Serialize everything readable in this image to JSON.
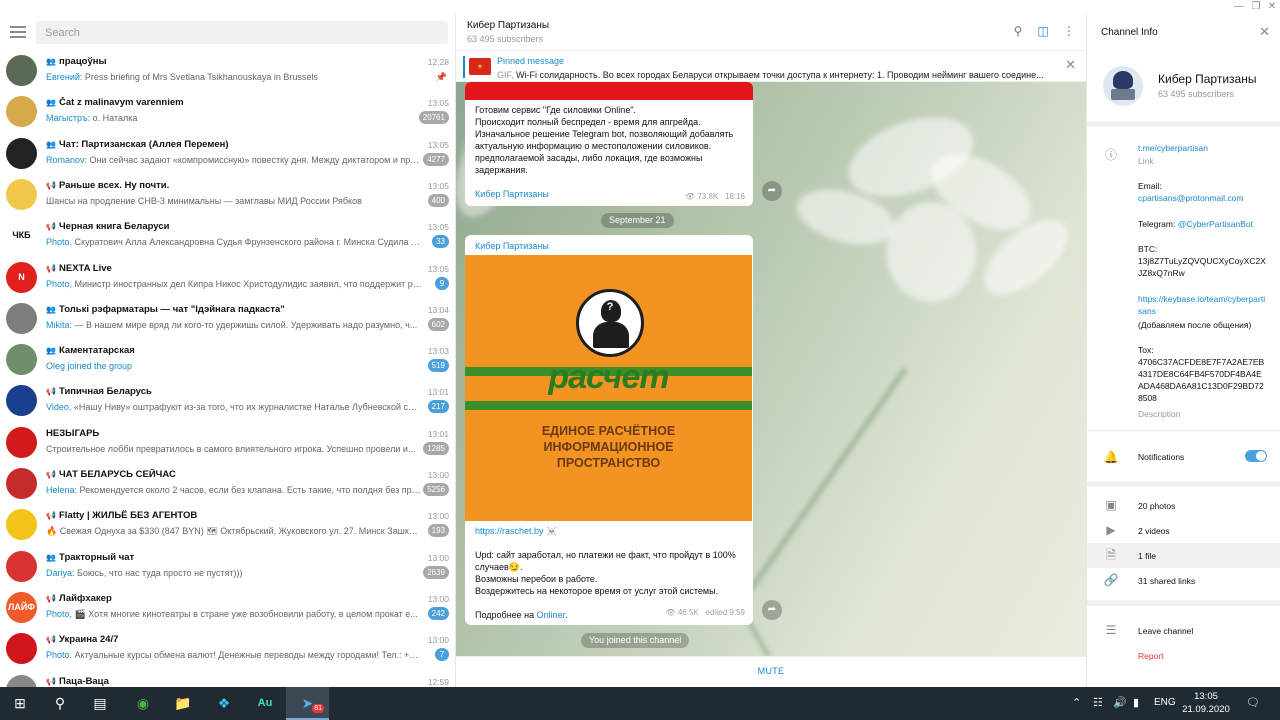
{
  "sidebar": {
    "search_placeholder": "Search",
    "chats": [
      {
        "type": "group",
        "name": "працоўны",
        "time": "12:28",
        "sender": "Евгений: ",
        "preview": "Press briefing of Mrs Svetlana Tsikhanouskaya in Brussels",
        "badge": "",
        "pinned": true,
        "avatar": "",
        "color": "#5a6a55"
      },
      {
        "type": "group",
        "name": "Čat z malinavym varenniem",
        "time": "13:05",
        "sender": "Магыстръ: ",
        "preview": "о. Наталка",
        "badge": "20761",
        "avatar": "",
        "color": "#d6a94a"
      },
      {
        "type": "group",
        "name": "Чат: Партизанская (Аллея Перемен)",
        "time": "13:05",
        "sender": "Romanov: ",
        "preview": "Они сейчас задают «компромиссную» повестку дня. Между диктатором и про...",
        "badge": "4277",
        "avatar": "",
        "color": "#222222"
      },
      {
        "type": "channel",
        "name": "Раньше всех. Ну почти.",
        "time": "13:05",
        "sender": "",
        "preview": "Шансы на продление СНВ-3 минимальны — замглавы МИД России Рябков",
        "badge": "400",
        "avatar": "",
        "color": "#f2c84a"
      },
      {
        "type": "channel",
        "name": "Черная книга Беларуси",
        "time": "13:05",
        "sender": "Photo, ",
        "preview": "Скуратович Алла Александровна Судья Фрунзенского района г. Минска Судила об...",
        "badge": "33",
        "badge_blue": true,
        "avatar": "ЧКБ",
        "color": "#ffffff"
      },
      {
        "type": "channel",
        "name": "NEXTA Live",
        "time": "13:05",
        "sender": "Photo, ",
        "preview": "Министр иностранных дел Кипра Никос Христодулидис заявил, что поддержит реше...",
        "badge": "9",
        "badge_blue": true,
        "avatar": "N",
        "color": "#e21f1f"
      },
      {
        "type": "group",
        "name": "Толькі рэфарматары — чат \"Ідэйнага падкаста\"",
        "time": "13:04",
        "sender": "Mikita: ",
        "preview": "— В нашем мире вряд ли кого-то удержишь силой. Удерживать надо разумно, ч...",
        "badge": "602",
        "avatar": "",
        "color": "#7d7d7d"
      },
      {
        "type": "group",
        "name": "Каментатарская",
        "time": "13:03",
        "sender": "",
        "preview": "Oleg joined the group",
        "badge": "519",
        "badge_blue": true,
        "preview_link": true,
        "avatar": "",
        "color": "#6f8f6a"
      },
      {
        "type": "channel",
        "name": "Типичная Беларусь",
        "time": "13:01",
        "sender": "Video, ",
        "preview": "«Нашу Ниву» оштрафуют из-за того, что их журналистке Наталье Лубневской сило...",
        "badge": "217",
        "badge_blue": true,
        "avatar": "",
        "color": "#1b3f8f"
      },
      {
        "type": "",
        "name": "НЕЗЫГАРЬ",
        "time": "13:01",
        "sender": "",
        "preview": "Строительное лобби превратилось в самого влиятельного игрока. Успешно провели и...",
        "badge": "1285",
        "avatar": "",
        "color": "#d11b1b"
      },
      {
        "type": "channel",
        "name": "ЧАТ БЕЛАРУСЬ СЕЙЧАС",
        "time": "13:00",
        "sender": "Helena: ",
        "preview": "Рекомендуется около 2 часов, если без клапана. Есть такие, что полдня без проб...",
        "badge": "5256",
        "avatar": "",
        "color": "#c62b2b"
      },
      {
        "type": "channel",
        "name": "Flatty | ЖИЛЬЁ БЕЗ АГЕНТОВ",
        "time": "13:00",
        "sender": "",
        "preview": "🔥 Свежая Однуха за $330 (847 BYN) 🗺 Октябрьский, Жуковского ул. 27. Минск Зашкварe...",
        "badge": "193",
        "avatar": "",
        "color": "#f2c318"
      },
      {
        "type": "group",
        "name": "Тракторный чат",
        "time": "13:00",
        "sender": "Dariya: ",
        "preview": "Боюсь, что нас туда просто не пустят)))",
        "badge": "2639",
        "avatar": "",
        "color": "#d83232"
      },
      {
        "type": "channel",
        "name": "Лайфхакер",
        "time": "13:00",
        "sender": "Photo, ",
        "preview": "🎬 Хотя многие кинотеатры в стране уже возобновили работу, в целом прокат е...",
        "badge": "242",
        "badge_blue": true,
        "avatar": "ЛАЙФ ХАКЕР",
        "color": "#f15a29"
      },
      {
        "type": "channel",
        "name": "Украина 24/7",
        "time": "13:00",
        "sender": "Photo. ",
        "preview": "Актуальные курсы обмена валют! Денежные переводы между городами! Тел.: +38...",
        "badge": "7",
        "badge_blue": true,
        "avatar": "",
        "color": "#d0151c"
      },
      {
        "type": "channel",
        "name": "Паца-Ваца",
        "time": "12:59",
        "sender": "",
        "preview": "",
        "badge": "",
        "avatar": "",
        "color": "#888888"
      }
    ]
  },
  "channel": {
    "title": "Кибер Партизаны",
    "subscribers": "63 495 subscribers",
    "pinned_label": "Pinned message",
    "pinned_prefix": "GIF, ",
    "pinned_text": "Wi-Fi солидарность.  Во всех городах Беларуси открываем точки доступа к интернету:  1. Проводим нейминг вашего соедине...",
    "msg1_lines": [
      "Готовим сервис \"Где силовики Online\".",
      "Происходит полный беспредел - время для апгрейда.",
      "Изначальное решение Telegram bot, позволяющий добавлять",
      "актуальную информацию о местоположении силовиков.",
      "предполагаемой засады, либо локация, где возможны",
      "задержания."
    ],
    "msg1_author": "Кибер Партизаны",
    "msg1_views": "73.8K",
    "msg1_time": "18:16",
    "date_label": "September 21",
    "msg2_author": "Кибер Партизаны",
    "poster_word": "расчет",
    "poster_slogan_1": "ЕДИНОЕ РАСЧЁТНОЕ",
    "poster_slogan_2": "ИНФОРМАЦИОННОЕ",
    "poster_slogan_3": "ПРОСТРАНСТВО",
    "msg2_link": "https://raschet.by",
    "msg2_link_emoji": "☠️",
    "msg2_line1": "Upd: сайт заработал, но платежи не факт, что пройдут в 100%",
    "msg2_line2": "случаев😏.",
    "msg2_line3": "Возможны перебои в работе.",
    "msg2_line4": "Воздержитесь на некоторое время от услуг этой системы.",
    "msg2_more": "Подробнее на ",
    "msg2_more_link": "Onliner",
    "msg2_more_end": ".",
    "msg2_views": "46.5K",
    "msg2_edited": "edited 9:59",
    "joined": "You joined this channel",
    "mute": "MUTE"
  },
  "info": {
    "title": "Channel Info",
    "name": "Кибер Партизаны",
    "subscribers": "63 495 subscribers",
    "link": "t.me/cyberpartisan",
    "link_label": "Link",
    "email_label": "Email:",
    "email": "cpartisans@protonmail.com",
    "telegram_label": "Telegram: ",
    "telegram": "@CyberPartisanBot",
    "btc_label": "BTC:",
    "btc": "13j8Z7TuLyZQVQUCXyCoyXC2XJZ8xQ7nRw",
    "keybase": "https://keybase.io/team/cyberpartisans",
    "keybase_note": "(Добавляем после общения)",
    "tox_label": "Tox:",
    "tox": "4706C37ACFDE8E7F7A2AE7EB4317DE8C64FB4F570DF4BA4EADA468DA6A81C13D0F29BD728508",
    "desc_label": "Description",
    "notifications": "Notifications",
    "notifications_on": true,
    "photos": "20 photos",
    "videos": "2 videos",
    "files": "1 file",
    "links": "31 shared links",
    "leave": "Leave channel",
    "report": "Report"
  },
  "taskbar": {
    "lang": "ENG",
    "time": "13:05",
    "date": "21.09.2020",
    "telegram_badge": "81"
  },
  "colors": {
    "accent": "#168acd",
    "badge_blue": "#4ba0dc",
    "badge_grey": "#a8a8a8",
    "report": "#e53935",
    "taskbar": "#1f2a33"
  }
}
